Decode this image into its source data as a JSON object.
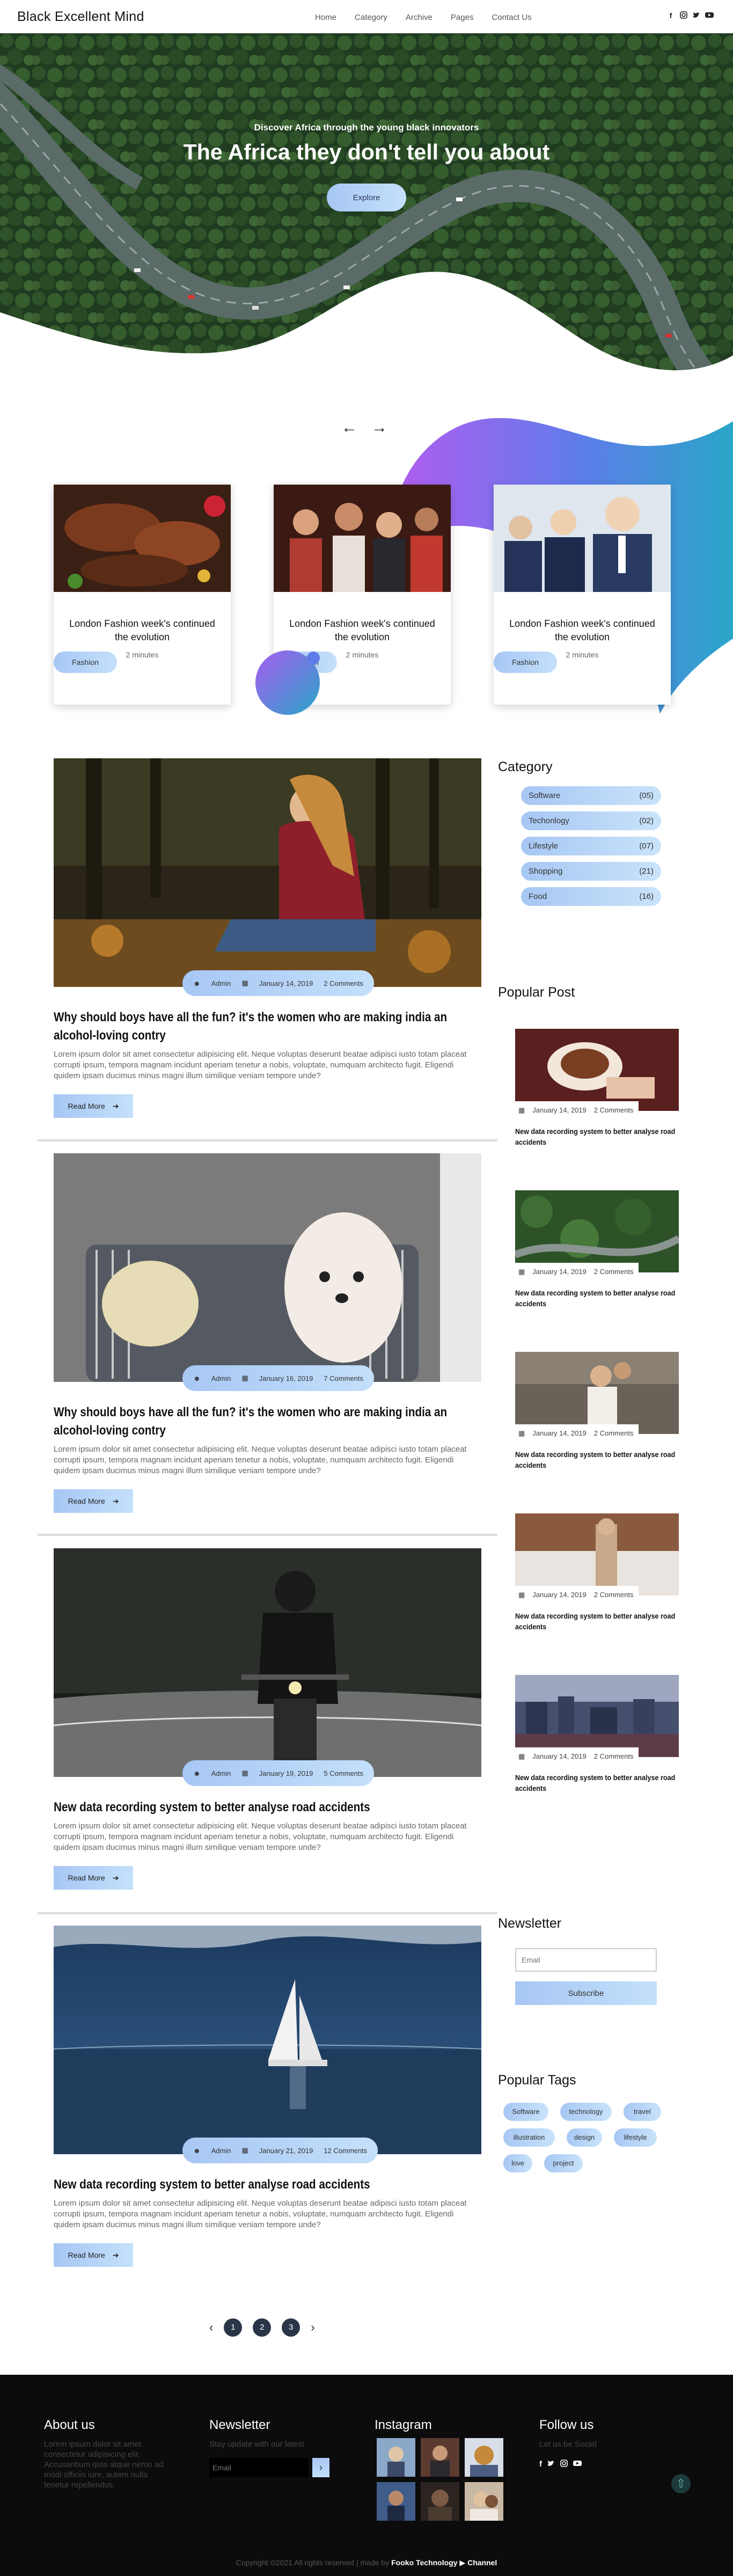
{
  "nav": {
    "brand": "Black Excellent Mind",
    "links": [
      "Home",
      "Category",
      "Archive",
      "Pages",
      "Contact Us"
    ],
    "social_icons": [
      "facebook-icon",
      "instagram-icon",
      "twitter-icon",
      "youtube-icon"
    ]
  },
  "hero": {
    "subtitle": "Discover Africa through the young black innovators",
    "title": "The Africa they don't tell you about",
    "button": "Explore"
  },
  "slider": {
    "prev": "←",
    "next": "→"
  },
  "featured": [
    {
      "title": "London Fashion week's continued the evolution",
      "tag": "Fashion",
      "time": "2 minutes"
    },
    {
      "title": "London Fashion week's continued the evolution",
      "tag": "Fashion",
      "time": "2 minutes"
    },
    {
      "title": "London Fashion week's continued the evolution",
      "tag": "Fashion",
      "time": "2 minutes"
    }
  ],
  "posts": [
    {
      "author": "Admin",
      "date": "January 14, 2019",
      "comments": "2 Comments",
      "title": "Why should boys have all the fun? it's the women who are making india an alcohol-loving contry",
      "excerpt": "Lorem ipsum dolor sit amet consectetur adipisicing elit. Neque voluptas deserunt beatae adipisci iusto totam placeat corrupti ipsum, tempora magnam incidunt aperiam tenetur a nobis, voluptate, numquam architecto fugit. Eligendi quidem ipsam ducimus minus magni illum similique veniam tempore unde?",
      "read_more": "Read More"
    },
    {
      "author": "Admin",
      "date": "January 16, 2019",
      "comments": "7 Comments",
      "title": "Why should boys have all the fun? it's the women who are making india an alcohol-loving contry",
      "excerpt": "Lorem ipsum dolor sit amet consectetur adipisicing elit. Neque voluptas deserunt beatae adipisci iusto totam placeat corrupti ipsum, tempora magnam incidunt aperiam tenetur a nobis, voluptate, numquam architecto fugit. Eligendi quidem ipsam ducimus minus magni illum similique veniam tempore unde?",
      "read_more": "Read More"
    },
    {
      "author": "Admin",
      "date": "January 19, 2019",
      "comments": "5 Comments",
      "title": "New data recording system to better analyse road accidents",
      "excerpt": "Lorem ipsum dolor sit amet consectetur adipisicing elit. Neque voluptas deserunt beatae adipisci iusto totam placeat corrupti ipsum, tempora magnam incidunt aperiam tenetur a nobis, voluptate, numquam architecto fugit. Eligendi quidem ipsam ducimus minus magni illum similique veniam tempore unde?",
      "read_more": "Read More"
    },
    {
      "author": "Admin",
      "date": "January 21, 2019",
      "comments": "12 Comments",
      "title": "New data recording system to better analyse road accidents",
      "excerpt": "Lorem ipsum dolor sit amet consectetur adipisicing elit. Neque voluptas deserunt beatae adipisci iusto totam placeat corrupti ipsum, tempora magnam incidunt aperiam tenetur a nobis, voluptate, numquam architecto fugit. Eligendi quidem ipsam ducimus minus magni illum similique veniam tempore unde?",
      "read_more": "Read More"
    }
  ],
  "sidebar": {
    "category_heading": "Category",
    "categories": [
      {
        "name": "Software",
        "count": "(05)"
      },
      {
        "name": "Techonlogy",
        "count": "(02)"
      },
      {
        "name": "Lifestyle",
        "count": "(07)"
      },
      {
        "name": "Shopping",
        "count": "(21)"
      },
      {
        "name": "Food",
        "count": "(16)"
      }
    ],
    "popular_heading": "Popular Post",
    "popular": [
      {
        "date": "January 14, 2019",
        "comments": "2 Comments",
        "title": "New data recording system to better analyse road accidents"
      },
      {
        "date": "January 14, 2019",
        "comments": "2 Comments",
        "title": "New data recording system to better analyse road accidents"
      },
      {
        "date": "January 14, 2019",
        "comments": "2 Comments",
        "title": "New data recording system to better analyse road accidents"
      },
      {
        "date": "January 14, 2019",
        "comments": "2 Comments",
        "title": "New data recording system to better analyse road accidents"
      },
      {
        "date": "January 14, 2019",
        "comments": "2 Comments",
        "title": "New data recording system to better analyse road accidents"
      }
    ],
    "newsletter_heading": "Newsletter",
    "newsletter_placeholder": "Email",
    "subscribe": "Subscribe",
    "tags_heading": "Popular Tags",
    "tags": [
      "Software",
      "technology",
      "travel",
      "illustration",
      "design",
      "lifestyle",
      "love",
      "project"
    ]
  },
  "pagination": {
    "prev": "‹",
    "pages": [
      "1",
      "2",
      "3"
    ],
    "next": "›"
  },
  "footer": {
    "about_heading": "About us",
    "about_text": "Lorem ipsum dolor sit amet consectetur adipisicing elit. Accusantium quia atque nemo ad modi officiis iure, autem nulla tenetur repellendus.",
    "newsletter_heading": "Newsletter",
    "newsletter_text": "Stay update with our latest",
    "email_placeholder": "Email",
    "send": "›",
    "instagram_heading": "Instagram",
    "follow_heading": "Follow us",
    "follow_text": "Let us be Social",
    "social_icons": [
      "facebook-icon",
      "twitter-icon",
      "instagram-icon",
      "youtube-icon"
    ],
    "copyright_prefix": "Copyright ©2021 All rights reserved | made by",
    "copyright_brand": "Fooko Technology",
    "copyright_suffix": "Channel"
  }
}
